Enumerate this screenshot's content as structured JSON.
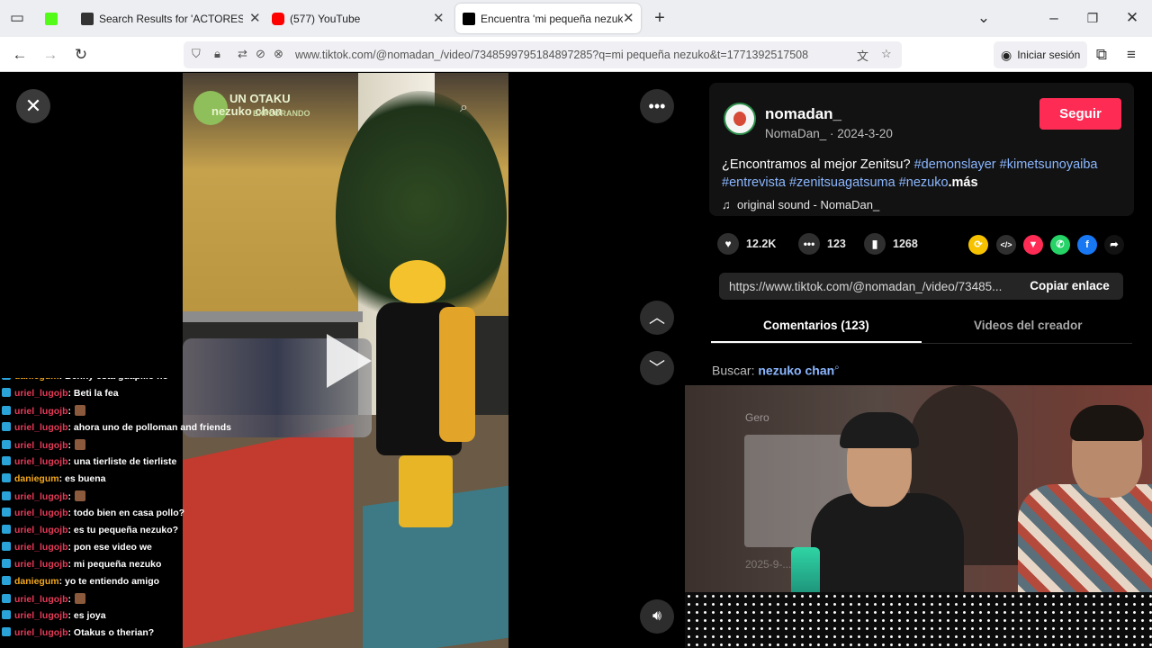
{
  "browser": {
    "tabs": [
      {
        "title": "",
        "favicon_color": "#53fc18"
      },
      {
        "title": "Search Results for 'ACTORES DE",
        "favicon_color": "#333333"
      },
      {
        "title": "(577) YouTube",
        "favicon_color": "#ff0000"
      },
      {
        "title": "Encuentra 'mi pequeña nezuko'",
        "favicon_color": "#000000"
      }
    ],
    "new_tab_icon": "plus-icon",
    "url": "www.tiktok.com/@nomadan_/video/7348599795184897285?q=mi pequeña nezuko&t=1771392517508",
    "signin_label": "Iniciar sesión"
  },
  "video": {
    "overlay_logo_text": "UN OTAKU",
    "overlay_logo_sub": "EXPLORANDO",
    "overlay_title": "nezuko chan"
  },
  "chat": [
    {
      "user": "daniegum",
      "color": "y",
      "text": ": Benny esta guapillo no",
      "emote": false
    },
    {
      "user": "uriel_lugojb",
      "color": "r",
      "text": ": Beti la fea",
      "emote": false
    },
    {
      "user": "uriel_lugojb",
      "color": "r",
      "text": ":",
      "emote": true
    },
    {
      "user": "uriel_lugojb",
      "color": "r",
      "text": ": ahora uno de polloman and friends",
      "emote": false
    },
    {
      "user": "uriel_lugojb",
      "color": "r",
      "text": ":",
      "emote": true
    },
    {
      "user": "uriel_lugojb",
      "color": "r",
      "text": ": una tierliste de tierliste",
      "emote": false
    },
    {
      "user": "daniegum",
      "color": "y",
      "text": ": es buena",
      "emote": false
    },
    {
      "user": "uriel_lugojb",
      "color": "r",
      "text": ":",
      "emote": true
    },
    {
      "user": "uriel_lugojb",
      "color": "r",
      "text": ": todo bien en casa pollo?",
      "emote": false
    },
    {
      "user": "uriel_lugojb",
      "color": "r",
      "text": ": es tu pequeña nezuko?",
      "emote": false
    },
    {
      "user": "uriel_lugojb",
      "color": "r",
      "text": ": pon ese video we",
      "emote": false
    },
    {
      "user": "uriel_lugojb",
      "color": "r",
      "text": ": mi pequeña nezuko",
      "emote": false
    },
    {
      "user": "daniegum",
      "color": "y",
      "text": ": yo te entiendo amigo",
      "emote": false
    },
    {
      "user": "uriel_lugojb",
      "color": "r",
      "text": ":",
      "emote": true
    },
    {
      "user": "uriel_lugojb",
      "color": "r",
      "text": ": es joya",
      "emote": false
    },
    {
      "user": "uriel_lugojb",
      "color": "r",
      "text": ": Otakus o therian?",
      "emote": false
    }
  ],
  "author": {
    "handle": "nomadan_",
    "nick_date": "NomaDan_ · 2024-3-20",
    "follow_label": "Seguir"
  },
  "description": {
    "text": "¿Encontramos al mejor Zenitsu?",
    "tags": [
      "#demonslayer",
      "#kimetsunoyaiba",
      "#entrevista",
      "#zenitsuagatsuma",
      "#nezuko"
    ],
    "more": ".más",
    "sound": "original sound - NomaDan_"
  },
  "stats": {
    "likes": "12.2K",
    "comments": "123",
    "saves": "1268"
  },
  "share_icons": [
    {
      "name": "repost-icon",
      "color": "#f7c300",
      "glyph": "⟳"
    },
    {
      "name": "embed-icon",
      "color": "#2f2f2f",
      "glyph": "</>"
    },
    {
      "name": "send-icon",
      "color": "#fe2c55",
      "glyph": "▼"
    },
    {
      "name": "whatsapp-icon",
      "color": "#25d366",
      "glyph": "✆"
    },
    {
      "name": "facebook-icon",
      "color": "#1877f2",
      "glyph": "f"
    },
    {
      "name": "share-arrow-icon",
      "color": "#121212",
      "glyph": "➦"
    }
  ],
  "link": {
    "url": "https://www.tiktok.com/@nomadan_/video/73485...",
    "copy_label": "Copiar enlace"
  },
  "tabs": {
    "comments": "Comentarios (123)",
    "creator": "Videos del creador"
  },
  "search": {
    "label": "Buscar:",
    "term": "nezuko chan"
  },
  "webcam_ghost": {
    "user": "Gero",
    "date": "2025-9-..."
  }
}
